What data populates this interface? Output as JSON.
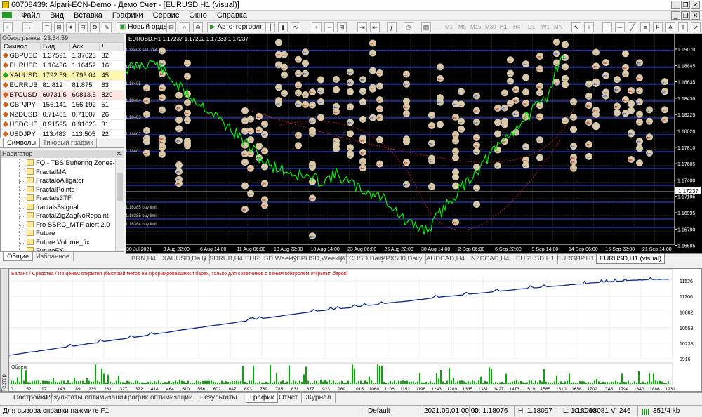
{
  "window": {
    "title": "60708439: Alpari-ECN-Demo - Демо Счет - [EURUSD,H1 (visual)]"
  },
  "menu": [
    "Файл",
    "Вид",
    "Вставка",
    "Графики",
    "Сервис",
    "Окно",
    "Справка"
  ],
  "toolbar": {
    "new_order": "Новый ордер",
    "autotrade": "Авто-торговля",
    "timeframes": [
      "M1",
      "M5",
      "M15",
      "M30",
      "H1",
      "H4",
      "D1",
      "W1",
      "MN"
    ]
  },
  "market_watch": {
    "header": "Обзор рынка: 23:54:59",
    "columns": [
      "Символ",
      "Бид",
      "Аск",
      "!"
    ],
    "rows": [
      {
        "symbol": "GBPUSD",
        "bid": "1.37591",
        "ask": "1.37623",
        "spread": "32",
        "color": "#d06020",
        "bg": "#ffffff"
      },
      {
        "symbol": "EURUSD",
        "bid": "1.16436",
        "ask": "1.16452",
        "spread": "16",
        "color": "#d06020",
        "bg": "#ffffff"
      },
      {
        "symbol": "XAUUSD",
        "bid": "1792.59",
        "ask": "1793.04",
        "spread": "45",
        "color": "#2a9a2a",
        "bg": "#fff6b0"
      },
      {
        "symbol": "EURRUB",
        "bid": "81.812",
        "ask": "81.875",
        "spread": "63",
        "color": "#d06020",
        "bg": "#ffffff"
      },
      {
        "symbol": "BTCUSD",
        "bid": "60731.5",
        "ask": "60813.5",
        "spread": "820",
        "color": "#d06020",
        "bg": "#ffe4e4"
      },
      {
        "symbol": "GBPJPY",
        "bid": "156.141",
        "ask": "156.192",
        "spread": "51",
        "color": "#d06020",
        "bg": "#ffffff"
      },
      {
        "symbol": "NZDUSD",
        "bid": "0.71481",
        "ask": "0.71507",
        "spread": "26",
        "color": "#d06020",
        "bg": "#ffffff"
      },
      {
        "symbol": "USDCHF",
        "bid": "0.91595",
        "ask": "0.91626",
        "spread": "31",
        "color": "#d06020",
        "bg": "#ffffff"
      },
      {
        "symbol": "USDJPY",
        "bid": "113.483",
        "ask": "113.505",
        "spread": "22",
        "color": "#d06020",
        "bg": "#ffffff"
      }
    ],
    "tabs": [
      "Символы",
      "Тиковый график"
    ]
  },
  "navigator": {
    "header": "Навигатор",
    "items": [
      "FQ - TBS Buffering Zones-",
      "FractalMA",
      "FractaloAlligator",
      "FractalPoints",
      "Fractals3TF",
      "fractals5signal",
      "FractalZigZagNoRepaint",
      "Fro SSRC_MTF-alert 2.0",
      "Future",
      "Future Volume_fix",
      "FutureFX"
    ],
    "tabs": [
      "Общие",
      "Избранное"
    ]
  },
  "chart": {
    "info": "EURUSD,H1 1.17237 1.17292 1.17233 1.17237",
    "price_labels": [
      "1.19070",
      "1.18845",
      "1.18635",
      "1.18430",
      "1.18225",
      "1.18020",
      "1.17810",
      "1.17605",
      "1.17400",
      "1.17195",
      "1.16995",
      "1.16790",
      "1.16585"
    ],
    "current_price": "1.17237",
    "time_labels": [
      "30 Jul 2021",
      "3 Aug 22:00",
      "6 Aug 14:00",
      "11 Aug 06:00",
      "13 Aug 22:00",
      "18 Aug 14:00",
      "23 Aug 06:00",
      "25 Aug 22:00",
      "30 Aug 14:00",
      "2 Sep 06:00",
      "6 Sep 22:00",
      "9 Sep 14:00",
      "14 Sep 06:00",
      "16 Sep 22:00",
      "21 Sep 14:00"
    ],
    "level_labels": [
      "1.18408 sell limit",
      "1.18406",
      "1.18405",
      "1.18404",
      "1.18403",
      "1.18402",
      "1.18401",
      "1.18385 buy limit",
      "1.18385 buy limit",
      "1.18384 buy limit"
    ]
  },
  "chart_tabs": [
    "BRN,H4",
    "XAUUSD,Daily",
    "USDRUB,H4",
    "EURUSD,Weekly",
    "GBPUSD,Weekly",
    "BTCUSD,Daily",
    "SPX500,Daily",
    "AUDCAD,H4",
    "NZDCAD,H4",
    "EURUSD,H1",
    "EURGBP,H1",
    "EURUSD,H1 (visual)"
  ],
  "tester_graph": {
    "legend": "Баланс / Средства / По ценам открытия (быстрый метод на сформировавшихся барах, только для советников с явным контролем открытия баров)",
    "y_labels": [
      "11526",
      "11206",
      "10882",
      "10558",
      "10238",
      "9916"
    ],
    "volume_label": "Объем",
    "x_labels": [
      "0",
      "52",
      "97",
      "143",
      "189",
      "235",
      "281",
      "327",
      "372",
      "418",
      "464",
      "510",
      "556",
      "602",
      "647",
      "693",
      "739",
      "785",
      "831",
      "877",
      "923",
      "969",
      "1015",
      "1060",
      "1106",
      "1152",
      "1198",
      "1243",
      "1289",
      "1335",
      "1381",
      "1427",
      "1473",
      "1519",
      "1565",
      "1610",
      "1656",
      "1702",
      "1748",
      "1794",
      "1840",
      "1886",
      "1931"
    ]
  },
  "chart_data": {
    "type": "line",
    "series": [
      {
        "name": "Баланс",
        "x": [
          0,
          100,
          200,
          300,
          400,
          500,
          600,
          700,
          800,
          900,
          1000,
          1100,
          1200,
          1300,
          1400,
          1500,
          1600,
          1650,
          1700,
          1750,
          1800,
          1850,
          1900,
          1950
        ],
        "values": [
          9990,
          10090,
          10190,
          10290,
          10390,
          10500,
          10600,
          10700,
          10800,
          10890,
          10970,
          11050,
          11130,
          11210,
          11280,
          11350,
          11410,
          11440,
          11470,
          11500,
          11520,
          11540,
          11555,
          11560
        ]
      }
    ],
    "ylim": [
      9916,
      11600
    ],
    "xlim": [
      0,
      1960
    ]
  },
  "tester_tabs": [
    "Настройки",
    "Результаты оптимизации",
    "График оптимизации",
    "Результаты",
    "График",
    "Отчет",
    "Журнал"
  ],
  "side_label": "Тестер",
  "statusbar": {
    "help": "Для вызова справки нажмите F1",
    "profile": "Default",
    "datetime": "2021.09.01 00:00",
    "open": "O: 1.18076",
    "high": "H: 1.18097",
    "low": "L: 1.18060",
    "close": "C: 1.18081",
    "volume": "V: 246",
    "traffic": "351/4 kb"
  }
}
